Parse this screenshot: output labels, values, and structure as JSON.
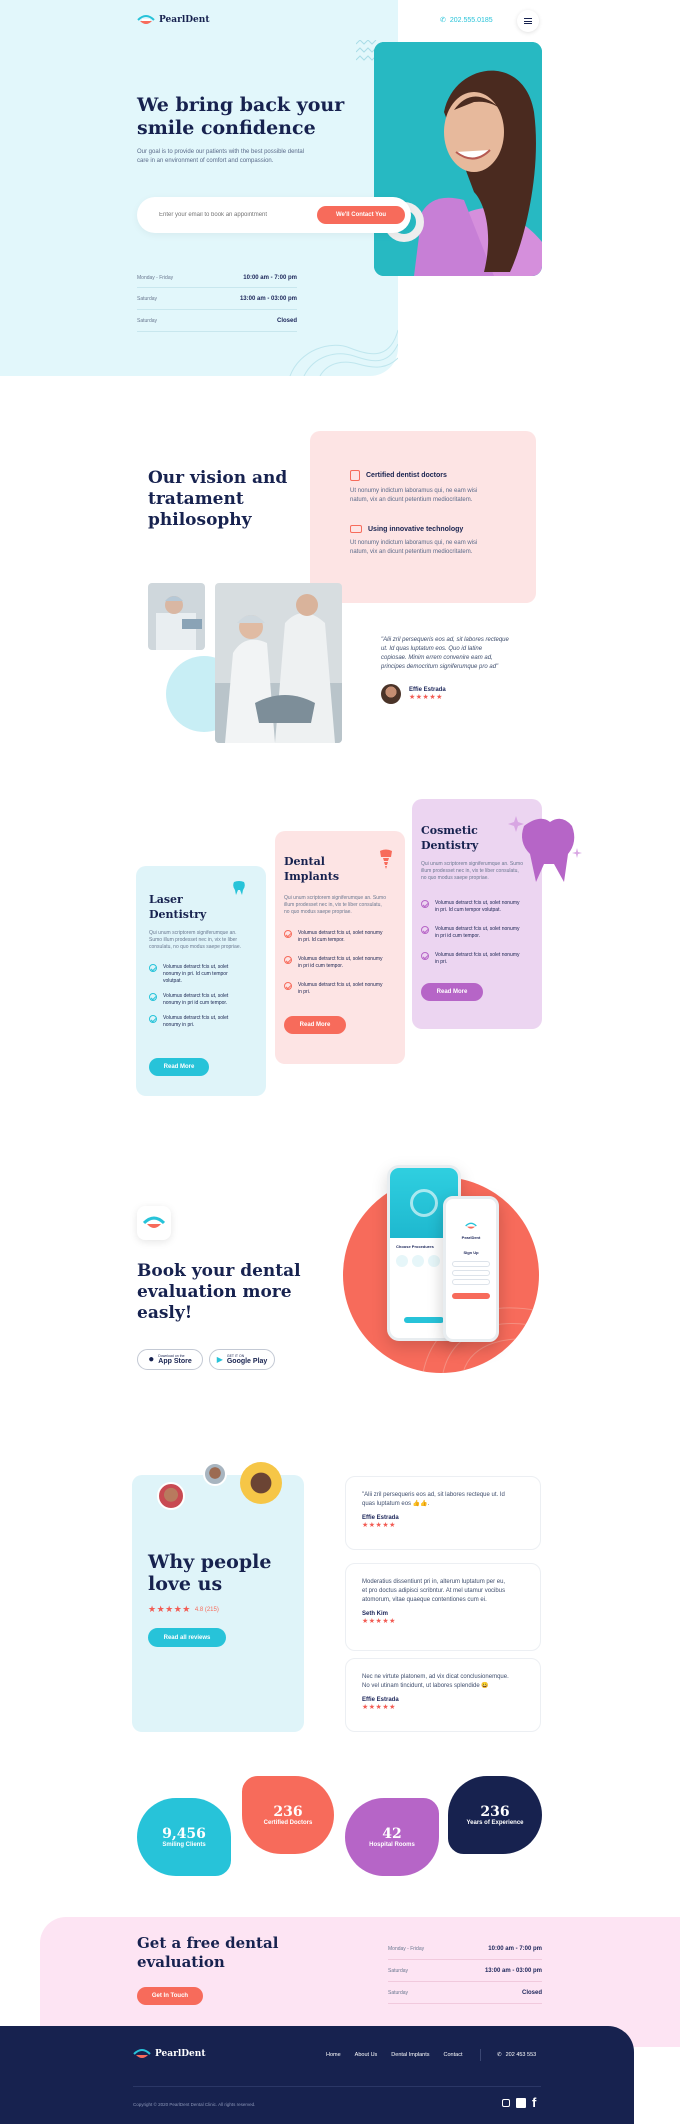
{
  "header": {
    "brand": "PearlDent",
    "phone": "202.555.0185"
  },
  "hero": {
    "title_line1": "We bring back your",
    "title_line2": "smile confidence",
    "subtitle_line1": "Our goal is to provide our patients with the best possible dental",
    "subtitle_line2": "care in an environment of comfort and compassion.",
    "email_placeholder": "Enter your email to book an appointment",
    "cta": "We'll Contact You",
    "hours": [
      {
        "day": "Monday - Friday",
        "time": "10:00 am - 7:00 pm"
      },
      {
        "day": "Saturday",
        "time": "13:00 am - 03:00 pm"
      },
      {
        "day": "Saturday",
        "time": "Closed"
      }
    ]
  },
  "vision": {
    "title_line1": "Our vision and",
    "title_line2": "tratament",
    "title_line3": "philosophy",
    "features": [
      {
        "title": "Certified dentist doctors",
        "text_line1": "Ut nonumy indictum laboramus qui, ne eam wisi",
        "text_line2": "natum, vix an dicunt petentium mediocritatem."
      },
      {
        "title": "Using innovative technology",
        "text_line1": "Ut nonumy indictum laboramus qui, ne eam wisi",
        "text_line2": "natum, vix an dicunt petentium mediocritatem."
      }
    ],
    "quote_line1": "\"Alii zril persequeris eos ad, sit labores recteque",
    "quote_line2": "ut. Id quas luptatum eos. Quo id latine",
    "quote_line3": "copiosae. Minim errem convenire eam ad,",
    "quote_line4": "principes democritum signiferumque pro ad\"",
    "author": "Effie Estrada",
    "stars": "★★★★★"
  },
  "services": [
    {
      "title_line1": "Laser",
      "title_line2": "Dentistry",
      "desc_line1": "Qui unum scriptorem signiferumque an.",
      "desc_line2": "Sumo illum prodesset nec in, vix te liber",
      "desc_line3": "consulatu, no quo modus saepe propriae.",
      "items": [
        [
          "Volumus detrarct fcis ut, solet",
          "nonumy in pri. Id cum tempor",
          "volutpat."
        ],
        [
          "Volumus detrarct fcis ut, solet",
          "nonumy in pri id cum tempor."
        ],
        [
          "Volumus detrarct fcis ut, solet",
          "nonumy in pri."
        ]
      ],
      "button": "Read More",
      "color": "#27c3d9"
    },
    {
      "title_line1": "Dental",
      "title_line2": "Implants",
      "desc_line1": "Qui unum scriptorem signiferumque an. Sumo",
      "desc_line2": "illum prodesset nec in, vix te liber consulatu,",
      "desc_line3": "no quo modus saepe propriae.",
      "items": [
        [
          "Volumus detrarct fcis ut, solet nonumy",
          "in pri. Id cum tempor."
        ],
        [
          "Volumus detrarct fcis ut, solet nonumy",
          "in pri id cum tempor."
        ],
        [
          "Volumus detrarct fcis ut, solet nonumy",
          "in pri."
        ]
      ],
      "button": "Read More",
      "color": "#f76b5b"
    },
    {
      "title_line1": "Cosmetic",
      "title_line2": "Dentistry",
      "desc_line1": "Qui unum scriptorem signiferumque an. Sumo",
      "desc_line2": "illum prodesset nec in, vix te liber consulatu,",
      "desc_line3": "no quo modus saepe propriae.",
      "items": [
        [
          "Volumus detrarct fcis ut, solet nonumy",
          "in pri. Id cum tempor volutpat."
        ],
        [
          "Volumus detrarct fcis ut, solet nonumy",
          "in pri id cum tempor."
        ],
        [
          "Volumus detrarct fcis ut, solet nonumy",
          "in pri."
        ]
      ],
      "button": "Read More",
      "color": "#b665c7"
    }
  ],
  "app": {
    "title_line1": "Book your dental",
    "title_line2": "evaluation more",
    "title_line3": "easly!",
    "appstore_small": "Download on the",
    "appstore": "App Store",
    "play_small": "GET IT ON",
    "play": "Google Play",
    "phone1_label": "Choose Procedures",
    "phone2_brand": "PearlDent",
    "phone2_title": "Sign Up"
  },
  "reviews": {
    "title_line1": "Why people",
    "title_line2": "love us",
    "stars": "★★★★★",
    "rating": "4.8 (215)",
    "button": "Read all reviews",
    "items": [
      {
        "line1": "\"Alii zril persequeris eos ad, sit labores recteque ut. Id",
        "line2": "quas luptatum eos 👍👍.",
        "author": "Effie Estrada",
        "stars": "★★★★★"
      },
      {
        "line1": "Moderatius dissentiunt pri in, alterum luptatum per eu,",
        "line2": "et pro doctus adipisci scribntur. At mel utamur vocibus",
        "line3": "atomorum, vitae quaeque contentiones cum ei.",
        "author": "Seth Kim",
        "stars": "★★★★★"
      },
      {
        "line1": "Nec ne virtute platonem, ad vix dicat conclusionemque.",
        "line2": "No vel utinam tincidunt, ut labores splendide 😀",
        "author": "Effie Estrada",
        "stars": "★★★★★"
      }
    ]
  },
  "stats": [
    {
      "value": "9,456",
      "label": "Smiling Clients",
      "color": "#27c3d9"
    },
    {
      "value": "236",
      "label": "Certified Doctors",
      "color": "#f76b5b"
    },
    {
      "value": "42",
      "label": "Hospital Rooms",
      "color": "#b665c7"
    },
    {
      "value": "236",
      "label": "Years of Experience",
      "color": "#17224f"
    }
  ],
  "cta": {
    "title_line1": "Get a free dental",
    "title_line2": "evaluation",
    "button": "Get In Touch",
    "hours": [
      {
        "day": "Monday - Friday",
        "time": "10:00 am - 7:00 pm"
      },
      {
        "day": "Saturday",
        "time": "13:00 am - 03:00 pm"
      },
      {
        "day": "Saturday",
        "time": "Closed"
      }
    ]
  },
  "footer": {
    "brand": "PearlDent",
    "nav": [
      "Home",
      "About Us",
      "Dental Implants",
      "Contact"
    ],
    "phone": "202 453 553",
    "copyright": "Copyright © 2020 PearlDent Dental Clinic. All rights reserved."
  },
  "colors": {
    "teal": "#27c3d9",
    "coral": "#f76b5b",
    "purple": "#b665c7",
    "navy": "#17224f",
    "light_cyan": "#e2f7fb",
    "light_pink": "#fde4e4",
    "light_purple": "#ecd5f1"
  }
}
